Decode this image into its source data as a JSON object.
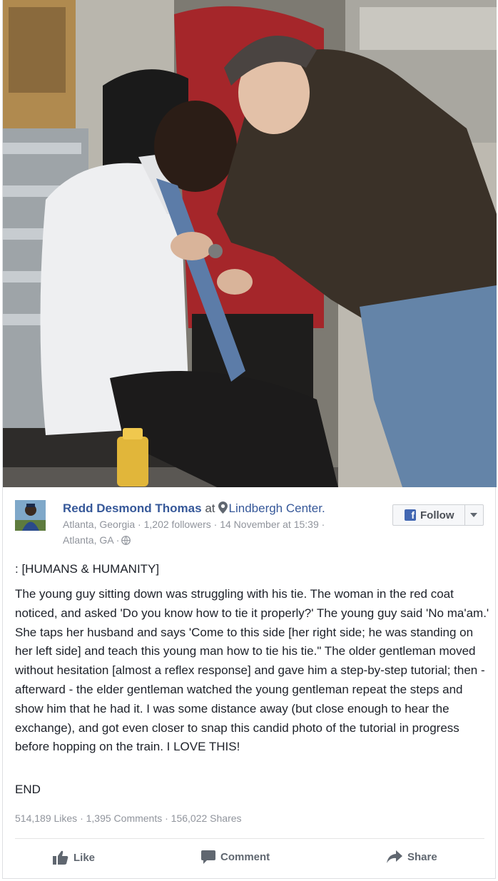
{
  "post": {
    "author": "Redd Desmond Thomas",
    "at_word": "at",
    "location": "Lindbergh Center.",
    "meta_line1": "Atlanta, Georgia · 1,202 followers · 14 November at 15:39 ·",
    "meta_line2": "Atlanta, GA ·",
    "follow_label": "Follow",
    "tagline": ": [HUMANS & HUMANITY]",
    "body": "The young guy sitting down was struggling with his tie. The woman in the red coat noticed, and asked 'Do you know how to tie it properly?' The young guy said 'No ma'am.' She taps her husband and says 'Come to this side [her right side; he was standing on her left side] and teach this young man how to tie his tie.\" The older gentleman moved without hesitation [almost a reflex response] and gave him a step-by-step tutorial; then - afterward - the elder gentleman watched the young gentleman repeat the steps and show him that he had it. I was some distance away (but close enough to hear the exchange), and got even closer to snap this candid photo of the tutorial in progress before hopping on the train. I LOVE THIS!",
    "end": "END",
    "stats": "514,189 Likes · 1,395 Comments · 156,022 Shares"
  },
  "actions": {
    "like": "Like",
    "comment": "Comment",
    "share": "Share"
  },
  "colors": {
    "link": "#365899",
    "meta": "#90949c",
    "fb_blue": "#4267b2"
  }
}
